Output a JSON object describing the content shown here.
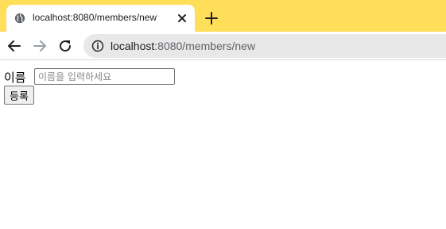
{
  "browser": {
    "accent_color": "#ffde59",
    "tab": {
      "title": "localhost:8080/members/new",
      "favicon": "globe-icon",
      "close_icon": "close-icon"
    },
    "new_tab_icon": "plus-icon",
    "toolbar": {
      "back_icon": "arrow-left-icon",
      "forward_icon": "arrow-right-icon",
      "reload_icon": "reload-icon",
      "site_info_icon": "info-icon",
      "url_host": "localhost",
      "url_rest": ":8080/members/new"
    }
  },
  "page": {
    "form": {
      "name_label": "이름",
      "name_input": {
        "value": "",
        "placeholder": "이름을 입력하세요"
      },
      "submit_label": "등록"
    }
  }
}
